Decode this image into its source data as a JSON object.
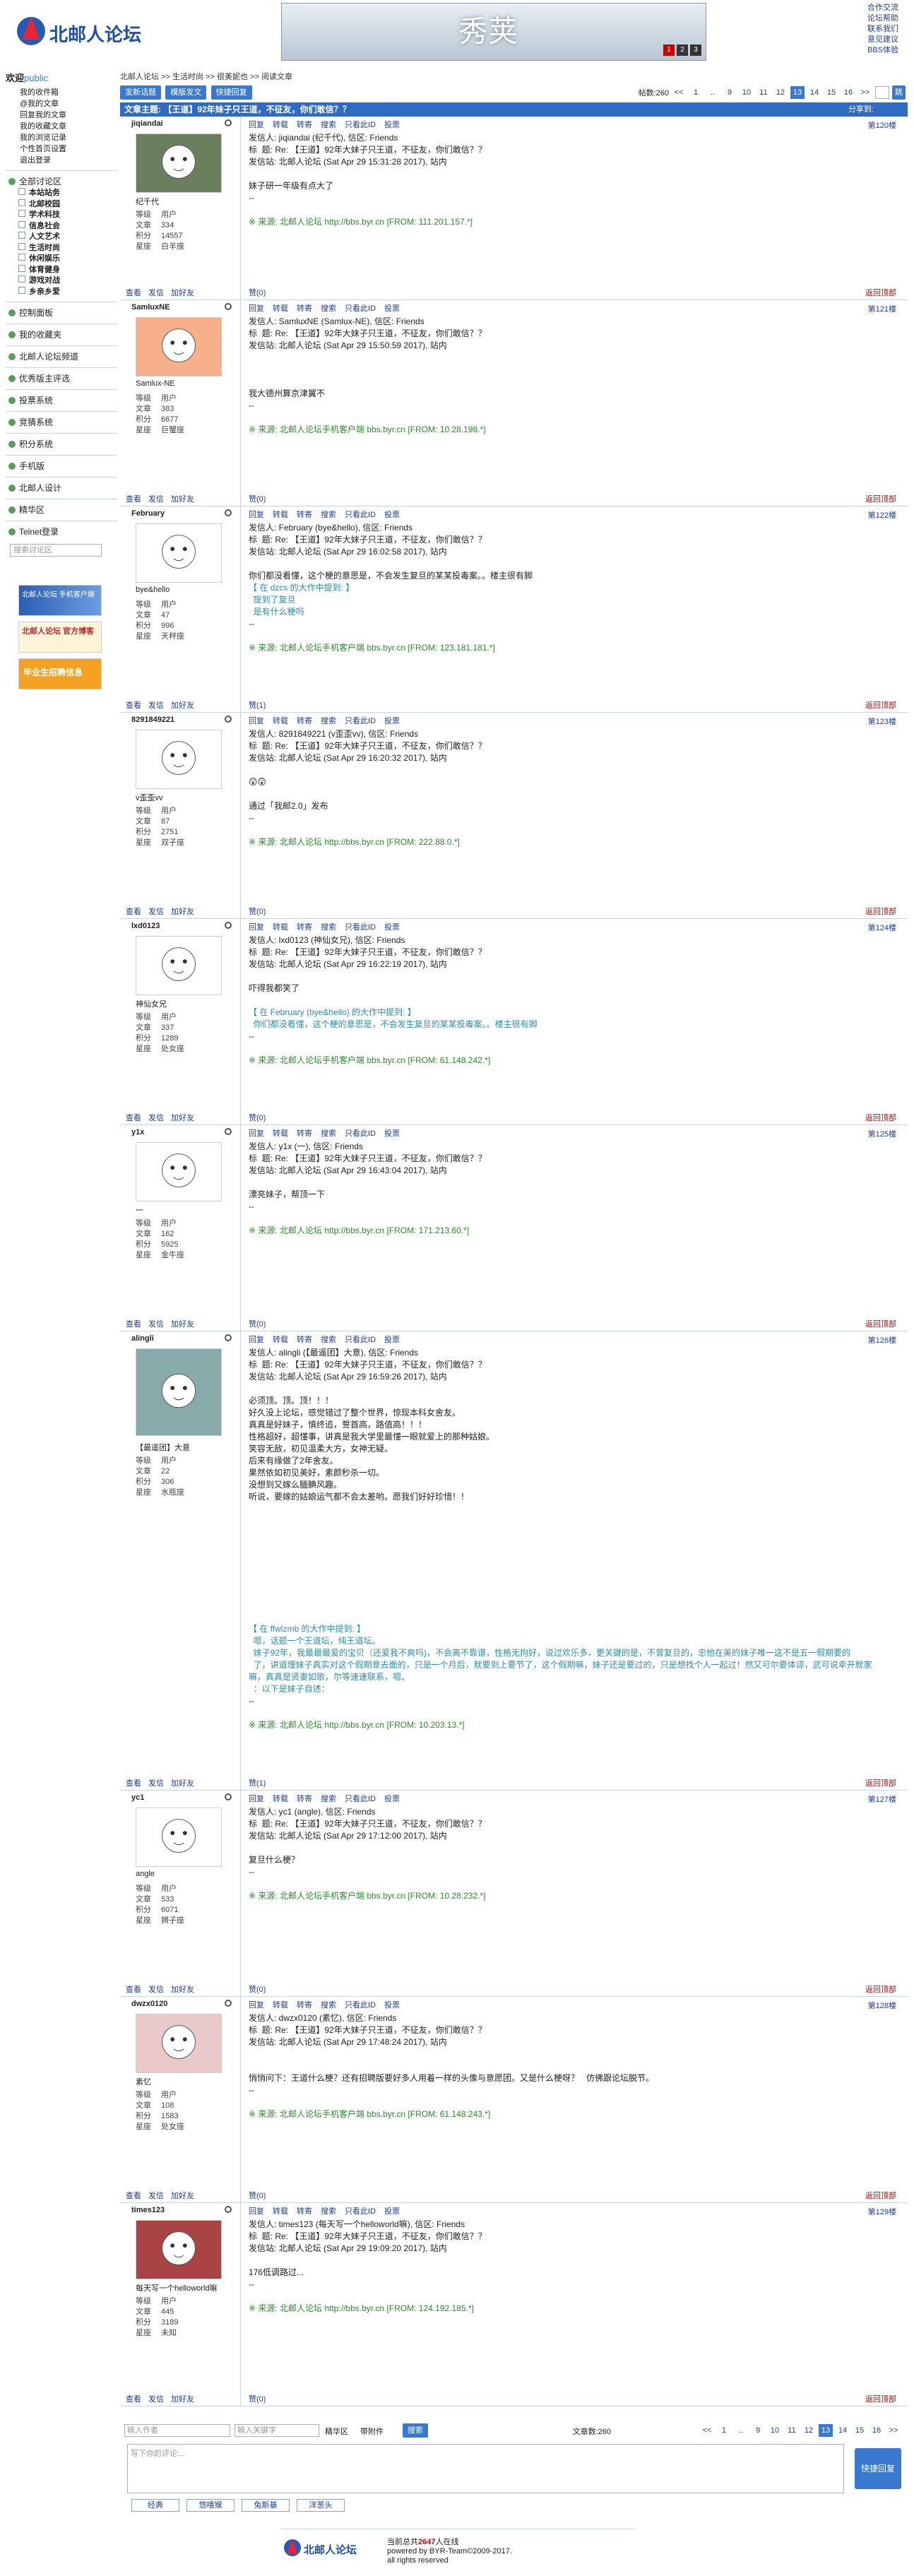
{
  "top": {
    "logo": "北邮人论坛",
    "banner_title": "秀荚",
    "banner_pages": [
      "1",
      "2",
      "3"
    ],
    "links": [
      "合作交流",
      "论坛帮助",
      "联系我们",
      "意见建议",
      "BBS体验"
    ]
  },
  "side": {
    "welcome": "欢迎",
    "user": "public",
    "menu": [
      "我的收件箱",
      "@我的文章",
      "回复我的文章",
      "我的收藏文章",
      "我的浏览记录",
      "个性首页设置",
      "退出登录"
    ],
    "forum": "全部讨论区",
    "boards": [
      "本站站务",
      "北邮校园",
      "学术科技",
      "信息社会",
      "人文艺术",
      "生活时尚",
      "休闲娱乐",
      "体育健身",
      "游戏对战",
      "乡亲乡爱"
    ],
    "sections": [
      "控制面板",
      "我的收藏夹",
      "北邮人论坛频道",
      "优秀版主评选",
      "投票系统",
      "竞猜系统",
      "积分系统",
      "手机版",
      "北邮人设计",
      "精华区",
      "Telnet登录"
    ],
    "search_placeholder": "搜索讨论区",
    "ads": [
      "北邮人论坛 手机客户端",
      "北邮人论坛 官方博客",
      "毕业生招聘信息"
    ]
  },
  "crumb": [
    "北邮人论坛",
    ">>",
    "生活时尚",
    ">>",
    "很美妮也",
    ">>",
    "阅读文章"
  ],
  "toolbar": {
    "buttons": [
      "发新话题",
      "模版发文",
      "快捷回复"
    ],
    "posts_label": "帖数:260",
    "pages": [
      "<<",
      "1",
      "..",
      "9",
      "10",
      "11",
      "12",
      "13",
      "14",
      "15",
      "16",
      ">>"
    ],
    "current": "13",
    "go": "跳"
  },
  "header": {
    "title": "文章主题: 【王道】92年妹子只王道，不征友，你们敢信？？",
    "share": "分享到:"
  },
  "tools": [
    "回复",
    "转载",
    "转寄",
    "搜索",
    "只看此ID",
    "投票"
  ],
  "foot_links": [
    "查看",
    "发信",
    "加好友"
  ],
  "to_top": "返回顶部",
  "posts": [
    {
      "uname": "jiqiandai",
      "floor": "第120楼",
      "nick": "纪千代",
      "stats": [
        [
          "等级",
          "用户"
        ],
        [
          "文章",
          "334"
        ],
        [
          "积分",
          "14557"
        ],
        [
          "星座",
          "白羊座"
        ]
      ],
      "votes": "赞(0)",
      "body": [
        "发信人: jiqiandai (纪千代), 信区: Friends",
        "标  题: Re: 【王道】92年大妹子只王道，不征友，你们敢信？？",
        "发信站: 北邮人论坛 (Sat Apr 29 15:31:28 2017), 站内",
        "",
        "妹子研一年级有点大了",
        "--",
        "",
        "※ 来源: 北邮人论坛 http://bbs.byr.cn [FROM: 111.201.157.*]"
      ]
    },
    {
      "uname": "SamluxNE",
      "floor": "第121楼",
      "nick": "Samlux-NE",
      "stats": [
        [
          "等级",
          "用户"
        ],
        [
          "文章",
          "383"
        ],
        [
          "积分",
          "6677"
        ],
        [
          "星座",
          "巨蟹座"
        ]
      ],
      "votes": "赞(0)",
      "body": [
        "发信人: SamluxNE (Samlux-NE), 信区: Friends",
        "标  题: Re: 【王道】92年大妹子只王道，不征友，你们敢信？？",
        "发信站: 北邮人论坛 (Sat Apr 29 15:50:59 2017), 站内",
        "",
        "",
        "",
        "我大德州算京津翼不",
        "--",
        "",
        "※ 来源: 北邮人论坛手机客户端 bbs.byr.cn [FROM: 10.28.198.*]"
      ]
    },
    {
      "uname": "February",
      "floor": "第122楼",
      "nick": "bye&hello",
      "stats": [
        [
          "等级",
          "用户"
        ],
        [
          "文章",
          "47"
        ],
        [
          "积分",
          "996"
        ],
        [
          "星座",
          "天秤座"
        ]
      ],
      "votes": "赞(1)",
      "body": [
        "发信人: February (bye&hello), 信区: Friends",
        "标  题: Re: 【王道】92年大妹子只王道，不征友，你们敢信？？",
        "发信站: 北邮人论坛 (Sat Apr 29 16:02:58 2017), 站内",
        "",
        "你们都没看懂，这个梗的意思是，不会发生复旦的某某投毒案。。楼主很有脚",
        "【 在 dzcs 的大作中提到: 】",
        "  提到了复旦",
        "  是有什么梗吗",
        "--",
        "",
        "※ 来源: 北邮人论坛手机客户端 bbs.byr.cn [FROM: 123.181.181.*]"
      ]
    },
    {
      "uname": "8291849221",
      "floor": "第123楼",
      "nick": "v歪歪vv",
      "stats": [
        [
          "等级",
          "用户"
        ],
        [
          "文章",
          "87"
        ],
        [
          "积分",
          "2751"
        ],
        [
          "星座",
          "双子座"
        ]
      ],
      "votes": "赞(0)",
      "body": [
        "发信人: 8291849221 (v歪歪vv), 信区: Friends",
        "标  题: Re: 【王道】92年大妹子只王道，不征友，你们敢信？？",
        "发信站: 北邮人论坛 (Sat Apr 29 16:20:32 2017), 站内",
        "",
        "😲😲",
        "",
        "通过「我邮2.0」发布",
        "--",
        "",
        "※ 来源: 北邮人论坛 http://bbs.byr.cn [FROM: 222.88.0.*]"
      ]
    },
    {
      "uname": "lxd0123",
      "floor": "第124楼",
      "nick": "神仙女兄",
      "stats": [
        [
          "等级",
          "用户"
        ],
        [
          "文章",
          "337"
        ],
        [
          "积分",
          "1289"
        ],
        [
          "星座",
          "处女座"
        ]
      ],
      "votes": "赞(0)",
      "body": [
        "发信人: lxd0123 (神仙女兄), 信区: Friends",
        "标  题: Re: 【王道】92年大妹子只王道，不征友，你们敢信？？",
        "发信站: 北邮人论坛 (Sat Apr 29 16:22:19 2017), 站内",
        "",
        "吓得我都笑了",
        "",
        "【 在 February (bye&hello) 的大作中提到: 】",
        "  你们都没看懂，这个梗的意思是，不会发生复旦的某某投毒案。。楼主很有脚",
        "--",
        "",
        "※ 来源: 北邮人论坛手机客户端 bbs.byr.cn [FROM: 61.148.242.*]"
      ]
    },
    {
      "uname": "y1x",
      "floor": "第125楼",
      "nick": "一",
      "stats": [
        [
          "等级",
          "用户"
        ],
        [
          "文章",
          "162"
        ],
        [
          "积分",
          "5925"
        ],
        [
          "星座",
          "金牛座"
        ]
      ],
      "votes": "赞(0)",
      "body": [
        "发信人: y1x (一), 信区: Friends",
        "标  题: Re: 【王道】92年大妹子只王道，不征友，你们敢信？？",
        "发信站: 北邮人论坛 (Sat Apr 29 16:43:04 2017), 站内",
        "",
        "漂亮妹子，帮顶一下",
        "--",
        "",
        "※ 来源: 北邮人论坛 http://bbs.byr.cn [FROM: 171.213.60.*]"
      ]
    },
    {
      "uname": "alingli",
      "floor": "第126楼",
      "nick": "【最遥团】大意",
      "stats": [
        [
          "等级",
          "用户"
        ],
        [
          "文章",
          "22"
        ],
        [
          "积分",
          "306"
        ],
        [
          "星座",
          "水瓶座"
        ]
      ],
      "votes": "赞(1)",
      "body": [
        "发信人: alingli (【最遥团】大意), 信区: Friends",
        "标  题: Re: 【王道】92年大妹子只王道，不征友，你们敢信？？",
        "发信站: 北邮人论坛 (Sat Apr 29 16:59:26 2017), 站内",
        "",
        "必须顶。顶。顶！！！",
        "好久没上论坛，感觉错过了整个世界，惊现本科女舍友。",
        "真真是好妹子，慎终追，誓首高，路值高！！！",
        "性格超好，超懂事，讲真是我大学里最懂一眼就爱上的那种姑娘。",
        "笑容无敌，初见温柔大方，女神无疑。",
        "后来有缘做了2年舍友。",
        "果然依如初见美好，素颜秒杀一切。",
        "没想到又嫁么腼腆风趣。",
        "听说，要嫁的姑娘运气都不会太差哟。愿我们好好珍惜！！",
        "",
        "",
        "",
        "",
        "",
        "",
        "",
        "",
        "",
        "",
        "【 在 ffwlzmb 的大作中提到: 】",
        "  嗯，话题一个王道坛，纯王道坛。",
        "  妹子92年，我最最最爱的宝贝（还爱我不爽吗)，不会离不靠谱，性格无拘好，说过欢乐多，更关键的是，不曾复旦的，忠他在美的妹子唯一这不是五一假期要的",
        "  了，讲道理妹子真实对这个假期意去面的，只是一个月后，就要到上要节了，这个假期嘛，妹子还是要过的，只是想找个人一起过！然又可尔要体谅，武可说幸开就家嘛，真真是贤妻如歌，尔等速速联系，嗯。",
        "  ：以下是妹子自述：",
        "--",
        "",
        "※ 来源: 北邮人论坛 http://bbs.byr.cn [FROM: 10.203.13.*]"
      ]
    },
    {
      "uname": "yc1",
      "floor": "第127楼",
      "nick": "angle",
      "stats": [
        [
          "等级",
          "用户"
        ],
        [
          "文章",
          "533"
        ],
        [
          "积分",
          "6071"
        ],
        [
          "星座",
          "狮子座"
        ]
      ],
      "votes": "赞(0)",
      "body": [
        "发信人: yc1 (angle), 信区: Friends",
        "标  题: Re: 【王道】92年大妹子只王道，不征友，你们敢信？？",
        "发信站: 北邮人论坛 (Sat Apr 29 17:12:00 2017), 站内",
        "",
        "复旦什么梗？",
        "--",
        "",
        "※ 来源: 北邮人论坛手机客户端 bbs.byr.cn [FROM: 10.28.232.*]"
      ]
    },
    {
      "uname": "dwzx0120",
      "floor": "第128楼",
      "nick": "素忆",
      "stats": [
        [
          "等级",
          "用户"
        ],
        [
          "文章",
          "108"
        ],
        [
          "积分",
          "1583"
        ],
        [
          "星座",
          "处女座"
        ]
      ],
      "votes": "赞(0)",
      "body": [
        "发信人: dwzx0120 (素忆), 信区: Friends",
        "标  题: Re: 【王道】92年大妹子只王道，不征友，你们敢信？？",
        "发信站: 北邮人论坛 (Sat Apr 29 17:48:24 2017), 站内",
        "",
        "",
        "悄悄问下：王道什么梗？还有招聘版要好多人用着一样的头像与意愿团。又是什么梗呀？   仿佛跟论坛脱节。",
        "--",
        "",
        "※ 来源: 北邮人论坛手机客户端 bbs.byr.cn [FROM: 61.148.243.*]"
      ]
    },
    {
      "uname": "times123",
      "floor": "第129楼",
      "nick": "每天写一个helloworld嘛",
      "stats": [
        [
          "等级",
          "用户"
        ],
        [
          "文章",
          "445"
        ],
        [
          "积分",
          "3189"
        ],
        [
          "星座",
          "未知"
        ]
      ],
      "votes": "赞(0)",
      "body": [
        "发信人: times123 (每天写一个helloworld嘛), 信区: Friends",
        "标  题: Re: 【王道】92年大妹子只王道，不征友，你们敢信？？",
        "发信站: 北邮人论坛 (Sat Apr 29 19:09:20 2017), 站内",
        "",
        "176低调路过...",
        "--",
        "",
        "※ 来源: 北邮人论坛 http://bbs.byr.cn [FROM: 124.192.185.*]"
      ]
    }
  ],
  "bottom": {
    "author_placeholder": "输入作者",
    "keyword_placeholder": "输入关键字",
    "search_label": "搜索",
    "digest": "精华区",
    "attach": "带附件",
    "count": "文章数:260"
  },
  "reply": {
    "placeholder": "写下你的评论…",
    "button": "快捷回复",
    "emoticons": [
      "经典",
      "悠嘻猴",
      "兔斯基",
      "洋葱头"
    ]
  },
  "footer": {
    "online_pre": "当前总共",
    "online_num": "2647",
    "online_post": "人在线",
    "powered": "powered by BYR-Team©2009-2017.",
    "rights": "all rights reserved"
  }
}
